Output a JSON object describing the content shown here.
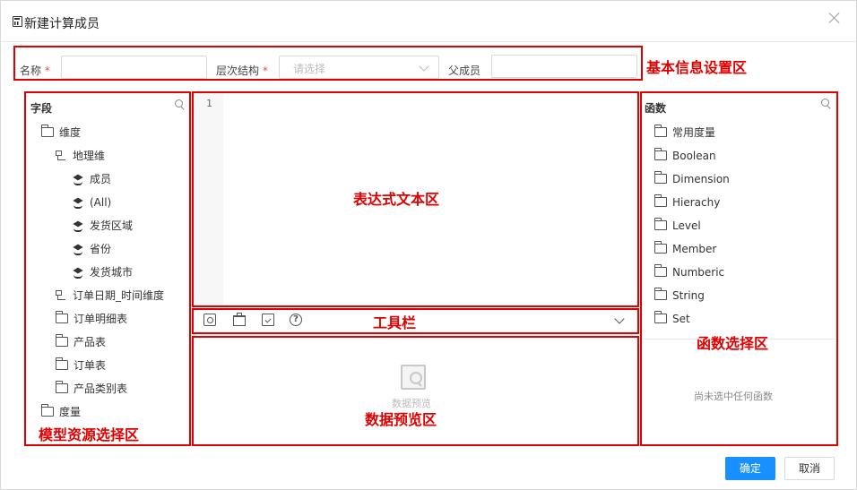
{
  "dialog": {
    "title": "新建计算成员",
    "ok_label": "确定",
    "cancel_label": "取消"
  },
  "basic_info": {
    "name_label": "名称",
    "required_mark": "*",
    "name_value": "",
    "hierarchy_label": "层次结构",
    "hierarchy_placeholder": "请选择",
    "parent_label": "父成员",
    "parent_value": ""
  },
  "fields_panel": {
    "title": "字段",
    "items": [
      {
        "label": "维度",
        "icon": "folder-open-icon"
      },
      {
        "label": "地理维",
        "icon": "hierarchy-icon"
      },
      {
        "label": "成员",
        "icon": "layers-icon"
      },
      {
        "label": "(All)",
        "icon": "layers-icon"
      },
      {
        "label": "发货区域",
        "icon": "layers-icon"
      },
      {
        "label": "省份",
        "icon": "layers-icon"
      },
      {
        "label": "发货城市",
        "icon": "layers-icon"
      },
      {
        "label": "订单日期_时间维度",
        "icon": "hierarchy-icon"
      },
      {
        "label": "订单明细表",
        "icon": "folder-icon"
      },
      {
        "label": "产品表",
        "icon": "folder-icon"
      },
      {
        "label": "订单表",
        "icon": "folder-icon"
      },
      {
        "label": "产品类别表",
        "icon": "folder-icon"
      },
      {
        "label": "度量",
        "icon": "folder-open-icon"
      }
    ]
  },
  "editor": {
    "line_number": "1",
    "content": ""
  },
  "toolbar": {
    "icons": [
      "find-icon",
      "box-icon",
      "check-icon",
      "help-icon"
    ],
    "help_glyph": "?"
  },
  "preview": {
    "empty_text": "数据预览"
  },
  "functions_panel": {
    "title": "函数",
    "items": [
      "常用度量",
      "Boolean",
      "Dimension",
      "Hierachy",
      "Level",
      "Member",
      "Numberic",
      "String",
      "Set"
    ],
    "empty_text": "尚未选中任何函数"
  },
  "annotations": {
    "basic_info": "基本信息设置区",
    "model_source": "模型资源选择区",
    "expression_text": "表达式文本区",
    "toolbar": "工具栏",
    "data_preview": "数据预览区",
    "function_select": "函数选择区",
    "color": "#e00000"
  },
  "colors": {
    "primary": "#1890ff",
    "required": "#e84c3d"
  }
}
